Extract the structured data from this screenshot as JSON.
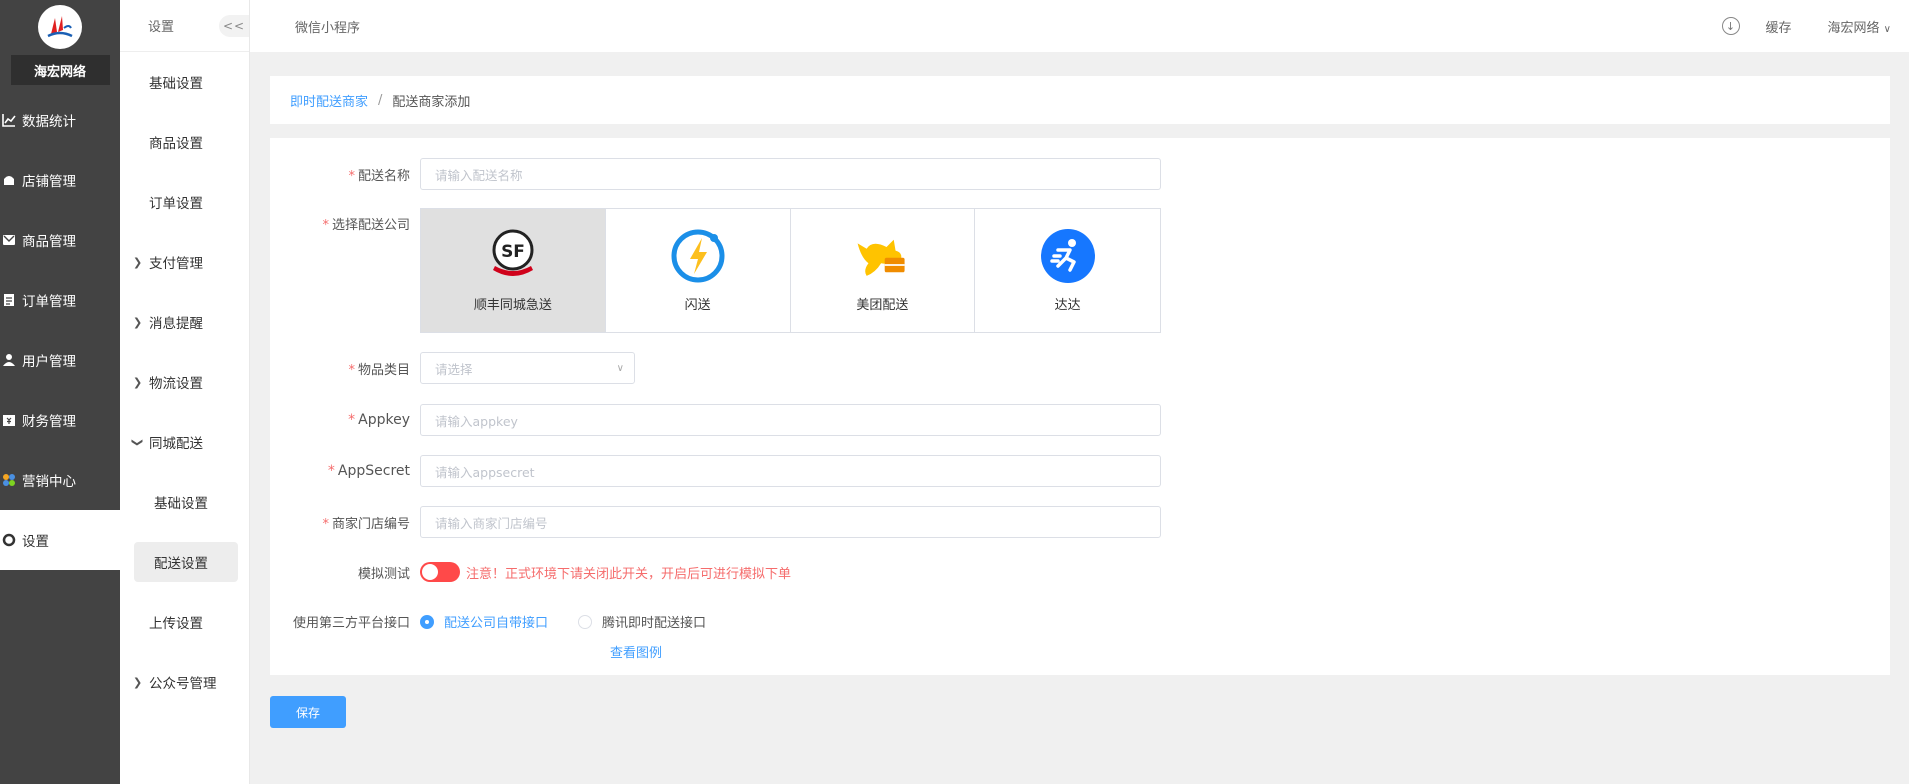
{
  "sidebar": {
    "brand": "海宏网络",
    "items": [
      {
        "label": "数据统计",
        "icon": "chart-line-icon"
      },
      {
        "label": "店铺管理",
        "icon": "store-icon"
      },
      {
        "label": "商品管理",
        "icon": "product-icon"
      },
      {
        "label": "订单管理",
        "icon": "order-icon"
      },
      {
        "label": "用户管理",
        "icon": "user-icon"
      },
      {
        "label": "财务管理",
        "icon": "finance-icon"
      },
      {
        "label": "营销中心",
        "icon": "marketing-icon"
      },
      {
        "label": "设置",
        "icon": "gear-icon"
      }
    ]
  },
  "subnav": {
    "title": "设置",
    "collapse": "<<",
    "items": [
      "基础设置",
      "商品设置",
      "订单设置",
      "支付管理",
      "消息提醒",
      "物流设置",
      "同城配送"
    ],
    "sub_items": [
      "基础设置",
      "配送设置"
    ],
    "items_after": [
      "上传设置",
      "公众号管理"
    ]
  },
  "topbar": {
    "tab": "微信小程序",
    "cache": "缓存",
    "user": "海宏网络"
  },
  "breadcrumb": {
    "parent": "即时配送商家",
    "sep": "/",
    "current": "配送商家添加"
  },
  "form": {
    "name_label": "配送名称",
    "name_placeholder": "请输入配送名称",
    "company_label": "选择配送公司",
    "companies": [
      "顺丰同城急送",
      "闪送",
      "美团配送",
      "达达"
    ],
    "category_label": "物品类目",
    "category_placeholder": "请选择",
    "appkey_label": "Appkey",
    "appkey_placeholder": "请输入appkey",
    "appsecret_label": "AppSecret",
    "appsecret_placeholder": "请输入appsecret",
    "store_label": "商家门店编号",
    "store_placeholder": "请输入商家门店编号",
    "test_label": "模拟测试",
    "test_warning": "注意！正式环境下请关闭此开关，开启后可进行模拟下单",
    "api_label": "使用第三方平台接口",
    "api_options": [
      "配送公司自带接口",
      "腾讯即时配送接口"
    ],
    "view_example": "查看图例",
    "save": "保存"
  },
  "colors": {
    "primary": "#409eff",
    "danger": "#ff4949",
    "sidebar": "#434343"
  }
}
